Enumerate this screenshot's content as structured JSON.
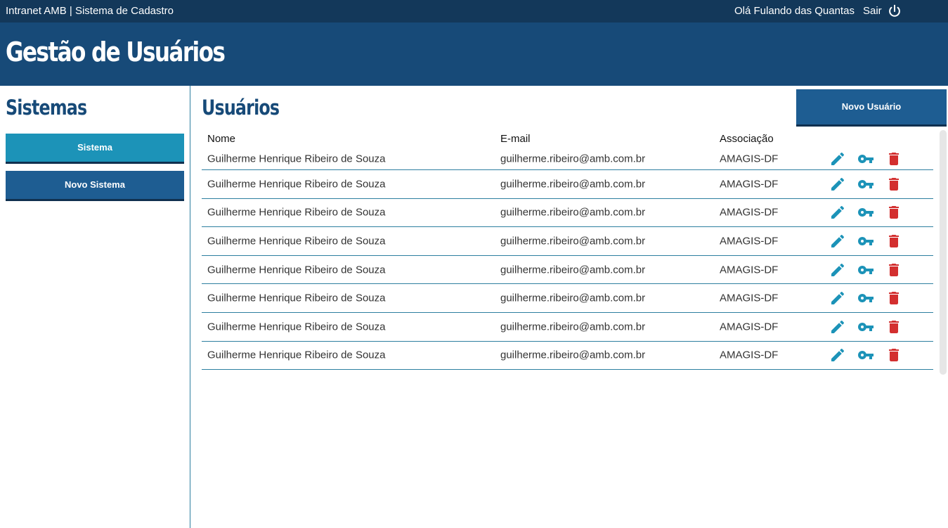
{
  "topbar": {
    "app_title": "Intranet AMB | Sistema de Cadastro",
    "greeting": "Olá Fulando das Quantas",
    "logout_label": "Sair",
    "logout_icon": "power-icon"
  },
  "banner": {
    "title": "Gestão de Usuários"
  },
  "sidebar": {
    "title": "Sistemas",
    "buttons": [
      {
        "label": "Sistema"
      },
      {
        "label": "Novo Sistema"
      }
    ]
  },
  "main": {
    "title": "Usuários",
    "new_user_label": "Novo Usuário",
    "columns": [
      "Nome",
      "E-mail",
      "Associação"
    ],
    "rows": [
      {
        "name": "Guilherme Henrique Ribeiro de Souza",
        "email": "guilherme.ribeiro@amb.com.br",
        "assoc": "AMAGIS-DF"
      },
      {
        "name": "Guilherme Henrique Ribeiro de Souza",
        "email": "guilherme.ribeiro@amb.com.br",
        "assoc": "AMAGIS-DF"
      },
      {
        "name": "Guilherme Henrique Ribeiro de Souza",
        "email": "guilherme.ribeiro@amb.com.br",
        "assoc": "AMAGIS-DF"
      },
      {
        "name": "Guilherme Henrique Ribeiro de Souza",
        "email": "guilherme.ribeiro@amb.com.br",
        "assoc": "AMAGIS-DF"
      },
      {
        "name": "Guilherme Henrique Ribeiro de Souza",
        "email": "guilherme.ribeiro@amb.com.br",
        "assoc": "AMAGIS-DF"
      },
      {
        "name": "Guilherme Henrique Ribeiro de Souza",
        "email": "guilherme.ribeiro@amb.com.br",
        "assoc": "AMAGIS-DF"
      },
      {
        "name": "Guilherme Henrique Ribeiro de Souza",
        "email": "guilherme.ribeiro@amb.com.br",
        "assoc": "AMAGIS-DF"
      },
      {
        "name": "Guilherme Henrique Ribeiro de Souza",
        "email": "guilherme.ribeiro@amb.com.br",
        "assoc": "AMAGIS-DF"
      }
    ],
    "row_action_icons": [
      "pencil-icon",
      "key-icon",
      "trash-icon"
    ]
  },
  "colors": {
    "topbar": "#13385a",
    "banner": "#174a78",
    "accent": "#1c93b8",
    "button": "#1e5d92",
    "delete": "#d32f2f"
  }
}
